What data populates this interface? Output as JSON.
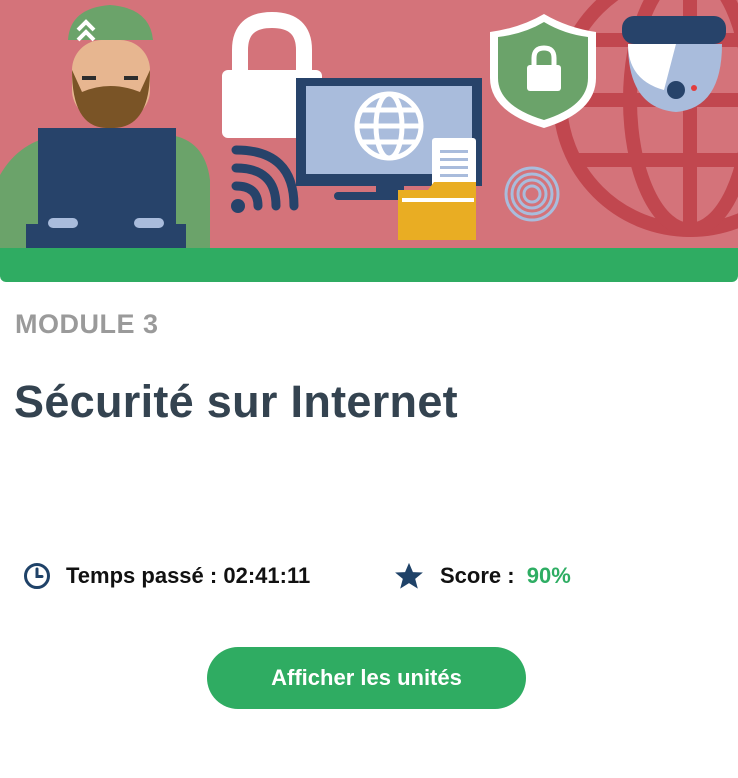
{
  "module": {
    "label": "MODULE 3",
    "title": "Sécurité sur Internet"
  },
  "progress": {
    "fraction": 1.0,
    "color": "#2fac62"
  },
  "stats": {
    "time": {
      "label": "Temps passé",
      "separator": " : ",
      "value": "02:41:11",
      "icon": "clock-icon"
    },
    "score": {
      "label": "Score",
      "separator": " : ",
      "value": "90%",
      "icon": "star-icon"
    }
  },
  "cta": {
    "label": "Afficher les unités"
  },
  "colors": {
    "accent_green": "#2fac62",
    "title": "#344350",
    "muted": "#9a9a9a",
    "banner_bg": "#d4737a",
    "navy": "#1f4268"
  }
}
